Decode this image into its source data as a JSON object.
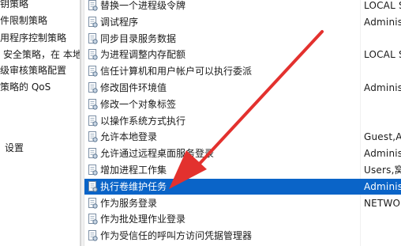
{
  "tree": {
    "items": [
      {
        "label": "钥策略"
      },
      {
        "label": "件限制策略"
      },
      {
        "label": "用程序控制策略"
      },
      {
        "label": "安全策略，在 本地"
      },
      {
        "label": "级审核策略配置"
      },
      {
        "label": "策略的 QoS"
      },
      {
        "label": "设置"
      }
    ]
  },
  "policies": {
    "rows": [
      {
        "name": "替换一个进程级令牌",
        "setting": "LOCAL S"
      },
      {
        "name": "调试程序",
        "setting": "Adminis"
      },
      {
        "name": "同步目录服务数据",
        "setting": ""
      },
      {
        "name": "为进程调整内存配额",
        "setting": "LOCAL S"
      },
      {
        "name": "信任计算机和用户帐户可以执行委派",
        "setting": ""
      },
      {
        "name": "修改固件环境值",
        "setting": "Adminis"
      },
      {
        "name": "修改一个对象标签",
        "setting": ""
      },
      {
        "name": "以操作系统方式执行",
        "setting": ""
      },
      {
        "name": "允许本地登录",
        "setting": "Guest,Ac"
      },
      {
        "name": "允许通过远程桌面服务登录",
        "setting": "Adminis"
      },
      {
        "name": "增加进程工作集",
        "setting": "Users,窝"
      },
      {
        "name": "执行卷维护任务",
        "setting": "Adminis"
      },
      {
        "name": "作为服务登录",
        "setting": "NETWO"
      },
      {
        "name": "作为批处理作业登录",
        "setting": ""
      },
      {
        "name": "作为受信任的呼叫方访问凭据管理器",
        "setting": ""
      }
    ],
    "selected_row": "执行卷维护任务"
  },
  "colors": {
    "selection": "#0a64c8",
    "arrow": "#e3312e",
    "splitter": "#d6d6d6"
  },
  "icons": {
    "policy": "policy-document-icon",
    "annotation": "red-arrow"
  }
}
